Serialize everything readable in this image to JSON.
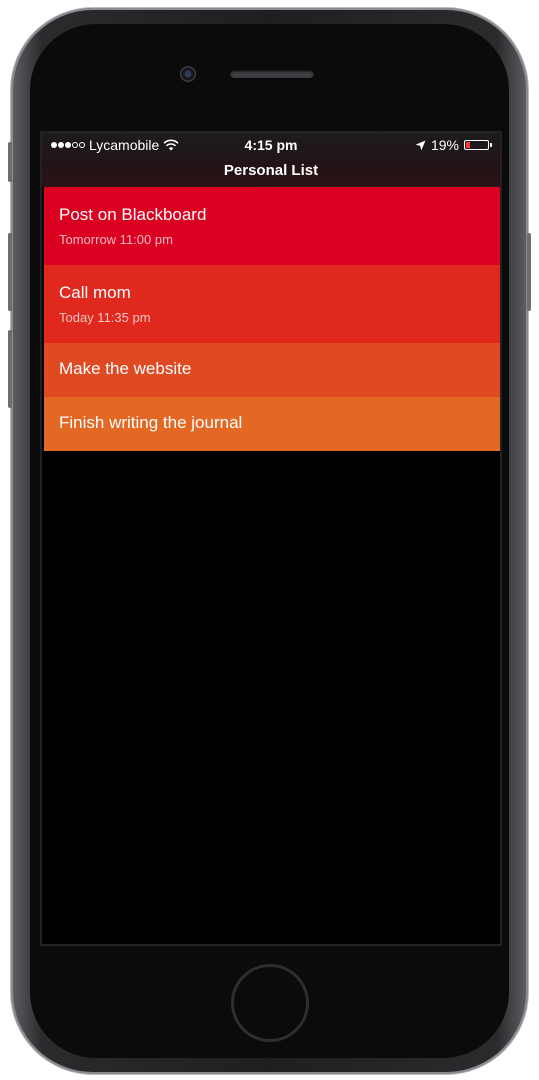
{
  "status_bar": {
    "carrier": "Lycamobile",
    "signal_bars_filled": 3,
    "signal_bars_total": 5,
    "time": "4:15 pm",
    "battery": "19%",
    "battery_level": 0.19,
    "battery_color": "#ff3b30"
  },
  "nav": {
    "title": "Personal List"
  },
  "tasks": [
    {
      "title": "Post on Blackboard",
      "due": "Tomorrow 11:00 pm",
      "color": "#dc0020"
    },
    {
      "title": "Call mom",
      "due": "Today 11:35 pm",
      "color": "#e0281f"
    },
    {
      "title": "Make the website",
      "due": "",
      "color": "#e04a22"
    },
    {
      "title": "Finish writing the journal",
      "due": "",
      "color": "#e36823"
    }
  ]
}
